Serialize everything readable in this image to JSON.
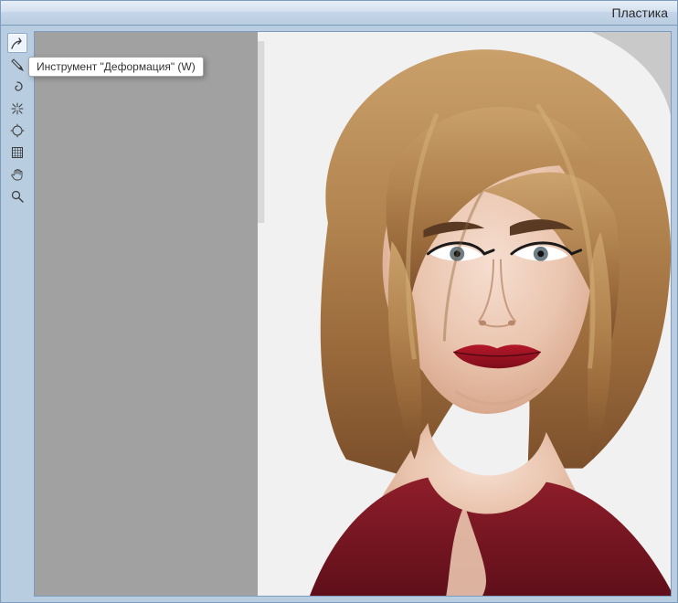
{
  "window": {
    "title": "Пластика"
  },
  "tooltip": {
    "text": "Инструмент \"Деформация\" (W)"
  },
  "tools": [
    {
      "name": "forward-warp",
      "selected": true
    },
    {
      "name": "reconstruct",
      "selected": false
    },
    {
      "name": "twirl",
      "selected": false
    },
    {
      "name": "pucker",
      "selected": false
    },
    {
      "name": "bloat",
      "selected": false
    },
    {
      "name": "freeze-mask",
      "selected": false
    },
    {
      "name": "hand",
      "selected": false
    },
    {
      "name": "zoom",
      "selected": false
    }
  ],
  "image": {
    "description": "Portrait photograph of a woman with shoulder-length wavy blonde/caramel hair, fair skin, defined eyebrows, cat-eye eyeliner, red lipstick, wearing a burgundy top. White backdrop with partial grey logo elements.",
    "background": "#f3f3f3"
  }
}
